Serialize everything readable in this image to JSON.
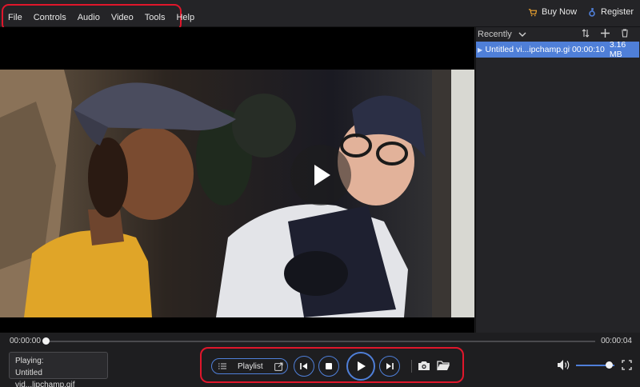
{
  "menu": {
    "items": [
      "File",
      "Controls",
      "Audio",
      "Video",
      "Tools",
      "Help"
    ]
  },
  "topbar": {
    "buy_now": "Buy Now",
    "register": "Register"
  },
  "sidebar": {
    "sort_label": "Recently",
    "items": [
      {
        "name": "Untitled vi...ipchamp.gif",
        "duration": "00:00:10",
        "size": "3.16 MB"
      }
    ]
  },
  "timeline": {
    "current": "00:00:00",
    "total": "00:00:04",
    "progress": 0
  },
  "now_playing": {
    "label": "Playing:",
    "file": "Untitled vid...lipchamp.gif"
  },
  "controls": {
    "playlist_label": "Playlist"
  },
  "volume": {
    "level": 0.85
  },
  "colors": {
    "accent": "#4f7fd8",
    "highlight": "#e0162b",
    "background": "#1e1e20"
  }
}
